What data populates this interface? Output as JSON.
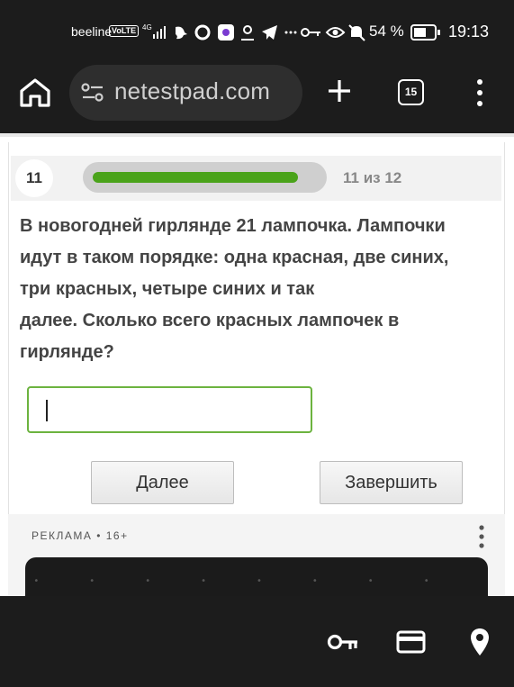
{
  "status_bar": {
    "carrier": "beeline",
    "volte": "VoLTE",
    "network": "4G",
    "battery_percent": "54 %",
    "time": "19:13",
    "icons": [
      "signal-icon",
      "bird-icon",
      "chat-icon",
      "app-icon",
      "location-icon",
      "telegram-icon",
      "more-icon",
      "key-icon",
      "eye-icon",
      "bell-off-icon",
      "battery-icon"
    ]
  },
  "browser": {
    "url": "netestpad.com",
    "tab_count": "15",
    "icons": [
      "home-icon",
      "tune-icon",
      "plus-icon",
      "tabs-icon",
      "menu-icon"
    ]
  },
  "quiz": {
    "question_number": "11",
    "progress_text": "11 из 12",
    "progress_fraction": 0.917,
    "question_lines": [
      "В новогодней гирлянде 21 лампочка. Лампочки",
      "идут в таком порядке: одна красная, две синих,",
      "три красных, четыре синих и так",
      "далее. Сколько всего красных лампочек в",
      "гирлянде?"
    ],
    "answer_value": "",
    "next_label": "Далее",
    "finish_label": "Завершить"
  },
  "ad": {
    "label": "РЕКЛАМА • 16+"
  },
  "bottom_bar": {
    "icons": [
      "key-icon",
      "credit-card-icon",
      "location-pin-icon"
    ]
  },
  "colors": {
    "accent_green": "#4aa31a",
    "input_border": "#6cb33f",
    "dark_chrome": "#1c1c1c"
  }
}
